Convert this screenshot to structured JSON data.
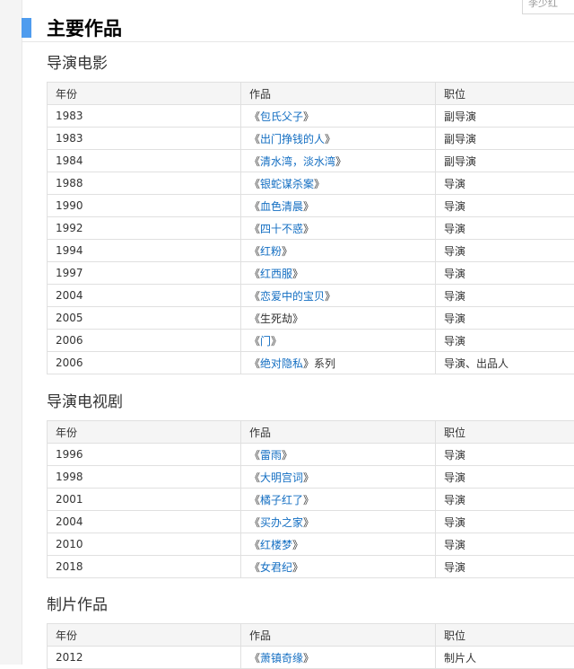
{
  "search_hint": "李少红",
  "section_title": "主要作品",
  "columns": {
    "year": "年份",
    "work": "作品",
    "role": "职位"
  },
  "tables": [
    {
      "title": "导演电影",
      "rows": [
        {
          "year": "1983",
          "work": "包氏父子",
          "suffix": "",
          "role": "副导演"
        },
        {
          "year": "1983",
          "work": "出门挣钱的人",
          "suffix": "",
          "role": "副导演"
        },
        {
          "year": "1984",
          "work": "清水湾，淡水湾",
          "suffix": "",
          "role": "副导演"
        },
        {
          "year": "1988",
          "work": "银蛇谋杀案",
          "suffix": "",
          "role": "导演"
        },
        {
          "year": "1990",
          "work": "血色清晨",
          "suffix": "",
          "role": "导演"
        },
        {
          "year": "1992",
          "work": "四十不惑",
          "suffix": "",
          "role": "导演"
        },
        {
          "year": "1994",
          "work": "红粉",
          "suffix": "",
          "role": "导演"
        },
        {
          "year": "1997",
          "work": "红西服",
          "suffix": "",
          "role": "导演"
        },
        {
          "year": "2004",
          "work": "恋爱中的宝贝",
          "suffix": "",
          "role": "导演"
        },
        {
          "year": "2005",
          "work": "生死劫",
          "suffix": "",
          "role": "导演",
          "plain": true
        },
        {
          "year": "2006",
          "work": "门",
          "suffix": "",
          "role": "导演"
        },
        {
          "year": "2006",
          "work": "绝对隐私",
          "suffix": "系列",
          "role": "导演、出品人"
        }
      ]
    },
    {
      "title": "导演电视剧",
      "rows": [
        {
          "year": "1996",
          "work": "雷雨",
          "suffix": "",
          "role": "导演"
        },
        {
          "year": "1998",
          "work": "大明宫词",
          "suffix": "",
          "role": "导演"
        },
        {
          "year": "2001",
          "work": "橘子红了",
          "suffix": "",
          "role": "导演"
        },
        {
          "year": "2004",
          "work": "买办之家",
          "suffix": "",
          "role": "导演"
        },
        {
          "year": "2010",
          "work": "红楼梦",
          "suffix": "",
          "role": "导演"
        },
        {
          "year": "2018",
          "work": "女君纪",
          "suffix": "",
          "role": "导演"
        }
      ]
    },
    {
      "title": "制片作品",
      "rows": [
        {
          "year": "2012",
          "work": "萧镇奇缘",
          "suffix": "",
          "role": "制片人"
        }
      ]
    }
  ]
}
